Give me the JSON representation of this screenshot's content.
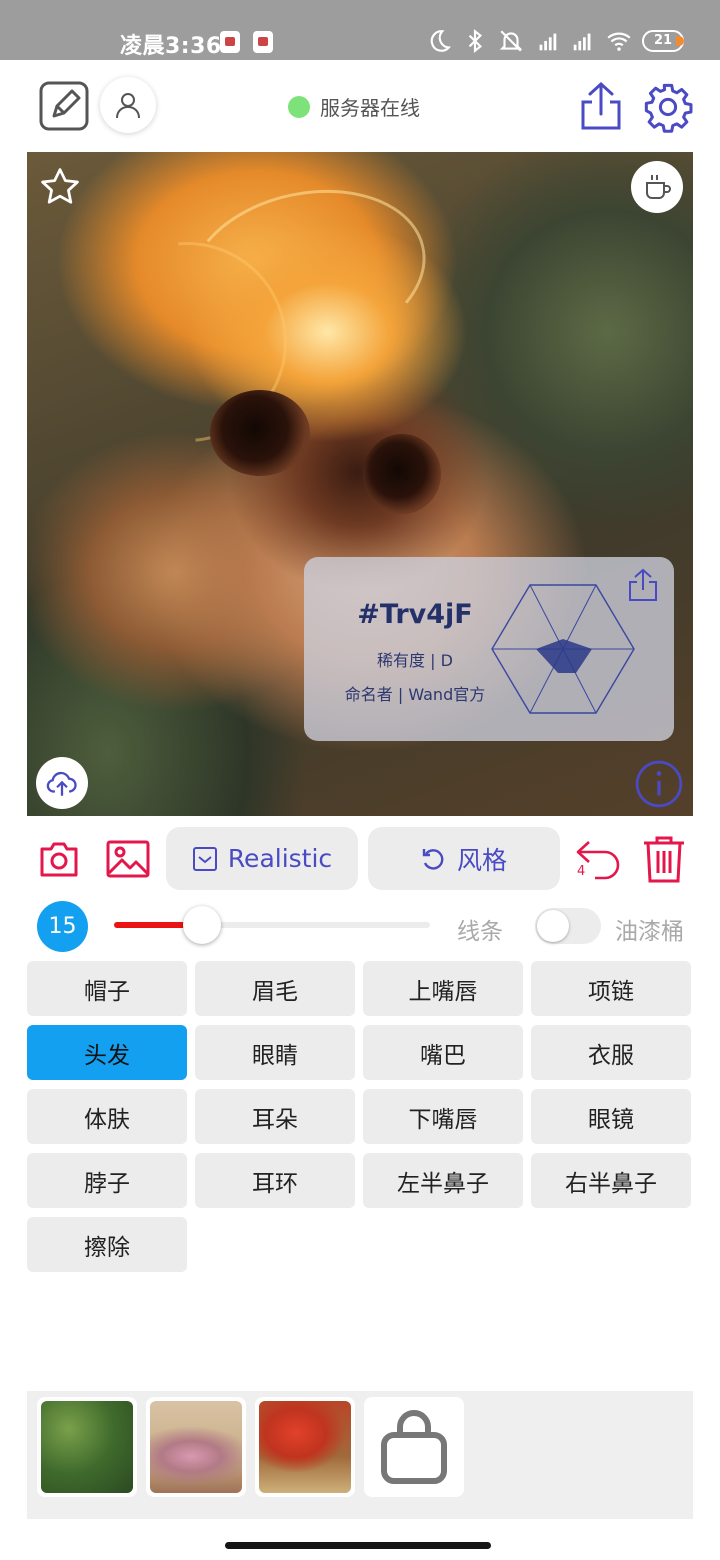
{
  "status_bar": {
    "time": "凌晨3:36",
    "battery": "21"
  },
  "header": {
    "server_status": "服务器在线",
    "server_color": "#7ee27a"
  },
  "card": {
    "code": "#Trv4jF",
    "rarity": "稀有度 | D",
    "namer": "命名者 | Wand官方"
  },
  "toolbar": {
    "realistic_label": "Realistic",
    "style_label": "风格",
    "undo_count": "4",
    "accent_color": "#e3174b",
    "brand_color": "#4a4bc4"
  },
  "brush": {
    "size": "15",
    "level": 0.28,
    "line_label": "线条",
    "bucket_label": "油漆桶",
    "bucket_enabled": false
  },
  "parts": [
    {
      "label": "帽子",
      "active": false
    },
    {
      "label": "眉毛",
      "active": false
    },
    {
      "label": "上嘴唇",
      "active": false
    },
    {
      "label": "项链",
      "active": false
    },
    {
      "label": "头发",
      "active": true
    },
    {
      "label": "眼睛",
      "active": false
    },
    {
      "label": "嘴巴",
      "active": false
    },
    {
      "label": "衣服",
      "active": false
    },
    {
      "label": "体肤",
      "active": false
    },
    {
      "label": "耳朵",
      "active": false
    },
    {
      "label": "下嘴唇",
      "active": false
    },
    {
      "label": "眼镜",
      "active": false
    },
    {
      "label": "脖子",
      "active": false
    },
    {
      "label": "耳环",
      "active": false
    },
    {
      "label": "左半鼻子",
      "active": false
    },
    {
      "label": "右半鼻子",
      "active": false
    },
    {
      "label": "擦除",
      "active": false
    }
  ],
  "style_thumbnails": [
    "green-foliage",
    "pink-blossom",
    "red-flowers",
    "store-bag-icon"
  ]
}
